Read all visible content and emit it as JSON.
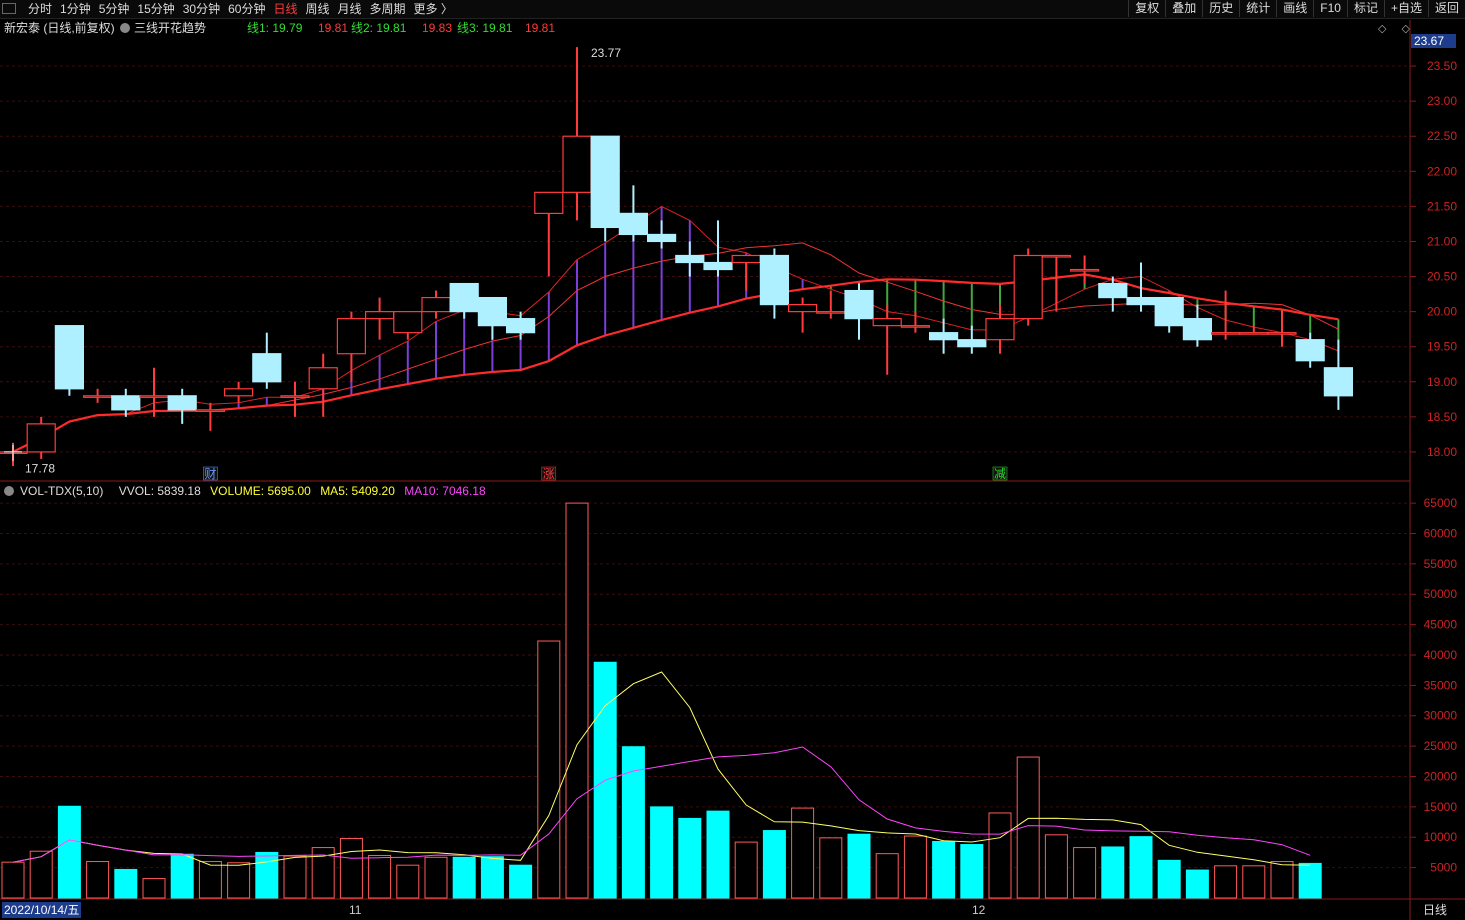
{
  "toolbar": {
    "tabs": [
      "分时",
      "1分钟",
      "5分钟",
      "15分钟",
      "30分钟",
      "60分钟",
      "日线",
      "周线",
      "月线",
      "多周期",
      "更多 〉"
    ],
    "active_tab": "日线",
    "right_tools": [
      "复权",
      "叠加",
      "历史",
      "统计",
      "画线",
      "F10",
      "标记",
      "+自选",
      "返回"
    ]
  },
  "info": {
    "stock": "新宏泰 (日线,前复权)",
    "indicator": "三线开花趋势",
    "line1_label": "线1: 19.79",
    "line1_val": "19.81",
    "line2_label": "线2: 19.81",
    "line2_val": "19.83",
    "line3_label": "线3: 19.81",
    "line3_val": "19.81",
    "current_price": "23.67",
    "icons": "◇ ◇"
  },
  "volume_info": {
    "name": "VOL-TDX(5,10)",
    "vvol": "VVOL: 5839.18",
    "volume": "VOLUME: 5695.00",
    "ma5": "MA5: 5409.20",
    "ma10": "MA10: 7046.18"
  },
  "bottom": {
    "date": "2022/10/14/五",
    "month1": "11",
    "month2": "12",
    "period": "日线"
  },
  "colors": {
    "up": "#ff3b3b",
    "down": "#aef0ff",
    "vol_down": "#00ffff",
    "ma5": "#ffff66",
    "ma10": "#ff44ff",
    "red_axis": "#cc2222"
  },
  "chart_data": [
    {
      "type": "candlestick",
      "y_ticks": [
        "23.50",
        "23.00",
        "22.50",
        "22.00",
        "21.50",
        "21.00",
        "20.50",
        "20.00",
        "19.50",
        "19.00",
        "18.50",
        "18.00"
      ],
      "ylim": [
        17.6,
        23.9
      ],
      "high_label": "23.77",
      "low_label": "17.78",
      "markers": [
        "财",
        "涨",
        "减"
      ],
      "candles": [
        [
          18.0,
          18.0,
          18.1,
          17.8
        ],
        [
          18.0,
          18.4,
          18.5,
          17.9
        ],
        [
          19.8,
          18.9,
          19.8,
          18.8
        ],
        [
          18.8,
          18.8,
          18.9,
          18.7
        ],
        [
          18.8,
          18.6,
          18.9,
          18.5
        ],
        [
          18.8,
          18.8,
          19.2,
          18.5
        ],
        [
          18.8,
          18.6,
          18.9,
          18.4
        ],
        [
          18.6,
          18.6,
          18.7,
          18.3
        ],
        [
          18.8,
          18.9,
          19.0,
          18.7
        ],
        [
          19.4,
          19.0,
          19.7,
          18.9
        ],
        [
          18.8,
          18.8,
          19.0,
          18.5
        ],
        [
          18.9,
          19.2,
          19.4,
          18.5
        ],
        [
          19.4,
          19.9,
          20.0,
          19.0
        ],
        [
          19.9,
          20.0,
          20.2,
          19.6
        ],
        [
          19.7,
          20.0,
          20.0,
          19.6
        ],
        [
          20.0,
          20.2,
          20.3,
          19.9
        ],
        [
          20.4,
          20.0,
          20.4,
          19.9
        ],
        [
          20.2,
          19.8,
          20.2,
          19.6
        ],
        [
          19.9,
          19.7,
          20.0,
          19.6
        ],
        [
          21.4,
          21.7,
          21.7,
          20.5
        ],
        [
          21.7,
          22.5,
          23.77,
          21.3
        ],
        [
          22.5,
          21.2,
          22.5,
          21.0
        ],
        [
          21.4,
          21.1,
          21.8,
          21.0
        ],
        [
          21.1,
          21.0,
          21.3,
          20.9
        ],
        [
          20.8,
          20.7,
          21.0,
          20.5
        ],
        [
          20.7,
          20.6,
          21.3,
          20.5
        ],
        [
          20.7,
          20.8,
          20.8,
          20.3
        ],
        [
          20.8,
          20.1,
          20.9,
          19.9
        ],
        [
          20.0,
          20.1,
          20.2,
          19.7
        ],
        [
          20.0,
          20.0,
          20.3,
          19.9
        ],
        [
          20.3,
          19.9,
          20.4,
          19.6
        ],
        [
          19.8,
          19.9,
          20.1,
          19.1
        ],
        [
          19.8,
          19.8,
          20.0,
          19.7
        ],
        [
          19.7,
          19.6,
          19.9,
          19.4
        ],
        [
          19.6,
          19.5,
          19.8,
          19.4
        ],
        [
          19.6,
          19.9,
          20.1,
          19.4
        ],
        [
          19.9,
          20.8,
          20.9,
          19.8
        ],
        [
          20.8,
          20.8,
          20.8,
          20.0
        ],
        [
          20.6,
          20.6,
          20.8,
          20.4
        ],
        [
          20.4,
          20.2,
          20.5,
          20.0
        ],
        [
          20.2,
          20.1,
          20.7,
          20.0
        ],
        [
          20.2,
          19.8,
          20.2,
          19.7
        ],
        [
          19.9,
          19.6,
          20.1,
          19.5
        ],
        [
          19.7,
          19.7,
          20.3,
          19.6
        ],
        [
          19.7,
          19.7,
          19.8,
          19.7
        ],
        [
          19.7,
          19.7,
          20.0,
          19.5
        ],
        [
          19.6,
          19.3,
          19.7,
          19.2
        ],
        [
          19.2,
          18.8,
          19.6,
          18.6
        ]
      ]
    },
    {
      "type": "bar",
      "y_ticks": [
        "65000",
        "60000",
        "55000",
        "50000",
        "45000",
        "40000",
        "35000",
        "30000",
        "25000",
        "20000",
        "15000",
        "10000",
        "5000"
      ],
      "ylim": [
        0,
        66500
      ],
      "values": [
        5900,
        7700,
        15100,
        6000,
        4700,
        3200,
        7200,
        6000,
        5800,
        7500,
        6900,
        8300,
        9800,
        7000,
        5400,
        6700,
        6700,
        6800,
        5400,
        42300,
        65000,
        38800,
        24900,
        15000,
        13100,
        14300,
        9200,
        11100,
        14800,
        9900,
        10500,
        7300,
        10200,
        9300,
        8800,
        14000,
        23200,
        10400,
        8300,
        8400,
        10100,
        6200,
        4600,
        5300,
        5300,
        6000,
        5695
      ]
    }
  ]
}
